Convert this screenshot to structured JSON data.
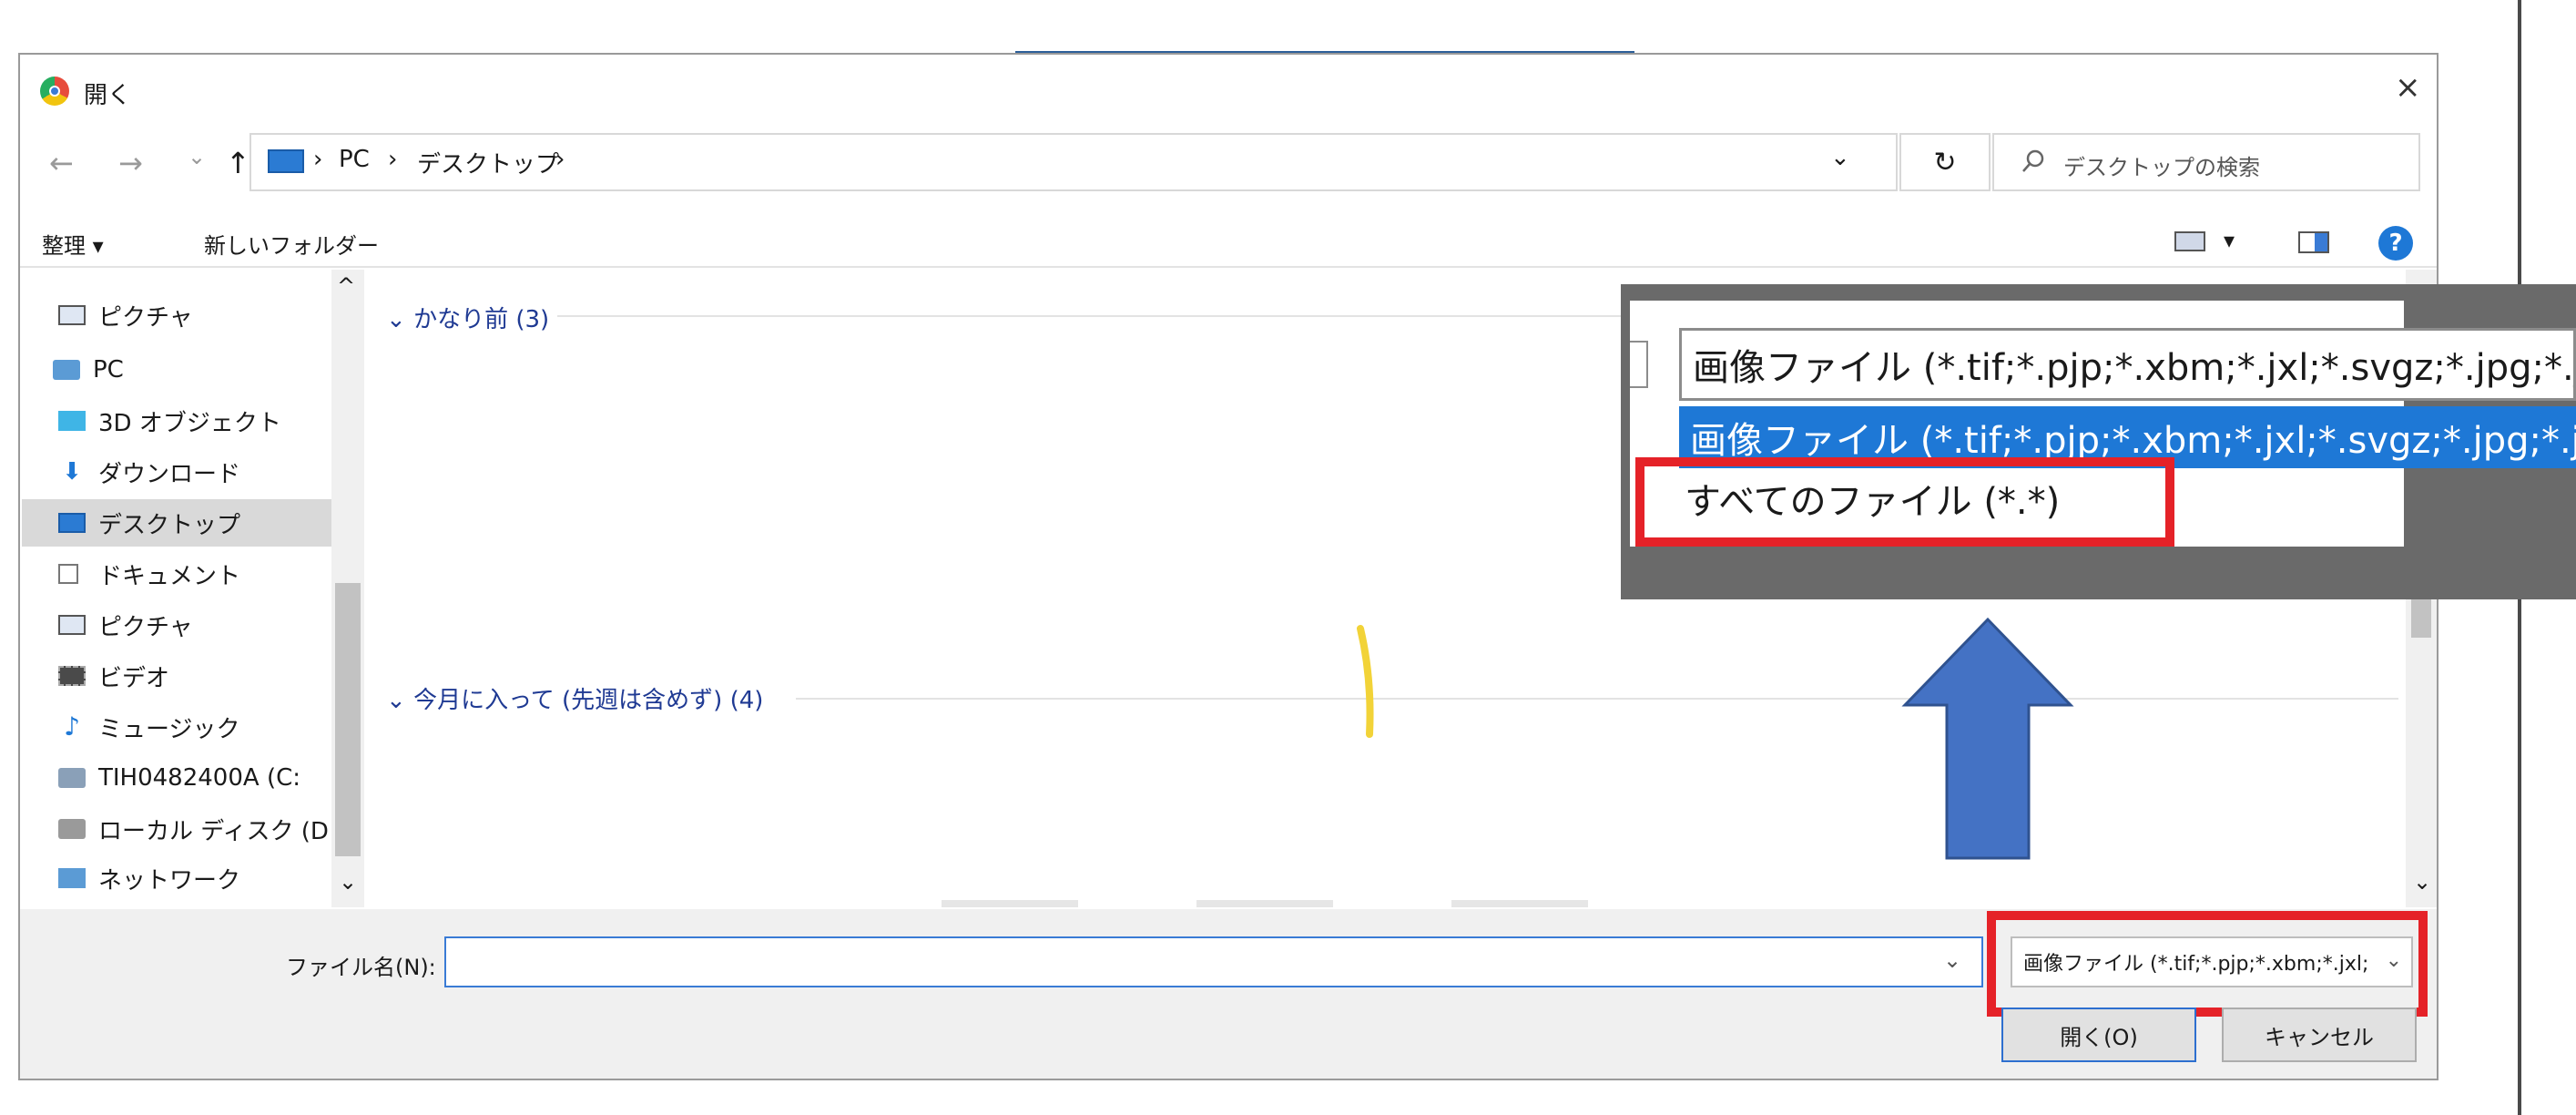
{
  "window": {
    "title": "開く",
    "close": "×"
  },
  "nav_buttons": {
    "back": "←",
    "forward": "→",
    "recent": "⌄",
    "up": "↑"
  },
  "breadcrumb": {
    "root": "PC",
    "sep": "›",
    "current": "デスクトップ",
    "trail": "›"
  },
  "address_controls": {
    "dropdown": "⌄",
    "refresh": "↻"
  },
  "search": {
    "placeholder": "デスクトップの検索"
  },
  "toolbar": {
    "organize": "整理 ▾",
    "new_folder": "新しいフォルダー",
    "view": "▾",
    "help": "?"
  },
  "nav_items": [
    {
      "label": "ピクチャ",
      "icon": "pictures-icon"
    },
    {
      "label": "PC",
      "icon": "pc-icon"
    },
    {
      "label": "3D オブジェクト",
      "icon": "3d-objects-icon"
    },
    {
      "label": "ダウンロード",
      "icon": "download-icon"
    },
    {
      "label": "デスクトップ",
      "icon": "desktop-icon",
      "selected": true
    },
    {
      "label": "ドキュメント",
      "icon": "document-icon"
    },
    {
      "label": "ピクチャ",
      "icon": "pictures-icon"
    },
    {
      "label": "ビデオ",
      "icon": "video-icon"
    },
    {
      "label": "ミュージック",
      "icon": "music-icon"
    },
    {
      "label": "TIH0482400A (C:",
      "icon": "drive-icon"
    },
    {
      "label": "ローカル ディスク (D",
      "icon": "drive-icon"
    },
    {
      "label": "ネットワーク",
      "icon": "network-icon"
    }
  ],
  "groups": [
    {
      "label": "かなり前 (3)"
    },
    {
      "label": "今月に入って (先週は含めず) (4)"
    }
  ],
  "bottom": {
    "filename_label": "ファイル名(N):",
    "filename_value": "",
    "filetype_value": "画像ファイル (*.tif;*.pjp;*.xbm;*.jxl;",
    "open_button": "開く(O)",
    "cancel_button": "キャンセル"
  },
  "inset": {
    "combo_text": "画像ファイル (*.tif;*.pjp;*.xbm;*.jxl;*.svgz;*.jpg;*.jpe",
    "highlight_text": "画像ファイル (*.tif;*.pjp;*.xbm;*.jxl;*.svgz;*.jpg;*.jpe",
    "all_files_text": "すべてのファイル (*.*)"
  },
  "colors": {
    "accent": "#1e78d6",
    "callout_red": "#e52228",
    "arrow_blue": "#4472c4",
    "group_header": "#1f3a93",
    "help_blue": "#1e78d6"
  }
}
